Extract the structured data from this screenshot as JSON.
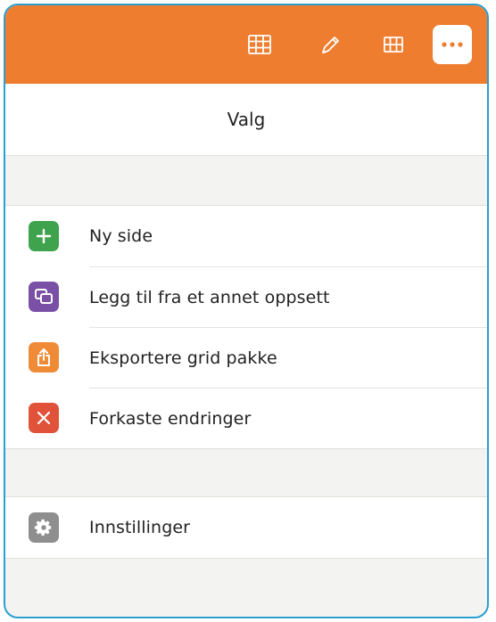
{
  "toolbar": {
    "background_color": "#ee7d2f",
    "icons": [
      "grid-icon",
      "edit-pencil-icon",
      "table-icon",
      "more-icon"
    ]
  },
  "header": {
    "title": "Valg"
  },
  "menu": {
    "items": [
      {
        "label": "Ny side",
        "icon": "plus-icon",
        "color": "#3fa34d"
      },
      {
        "label": "Legg til fra et annet oppsett",
        "icon": "copy-icon",
        "color": "#7a4fa6"
      },
      {
        "label": "Eksportere grid pakke",
        "icon": "export-icon",
        "color": "#ef8a36"
      },
      {
        "label": "Forkaste endringer",
        "icon": "close-icon",
        "color": "#e0523a"
      }
    ]
  },
  "settings": {
    "label": "Innstillinger",
    "icon": "gear-icon",
    "color": "#8e8e8e"
  }
}
